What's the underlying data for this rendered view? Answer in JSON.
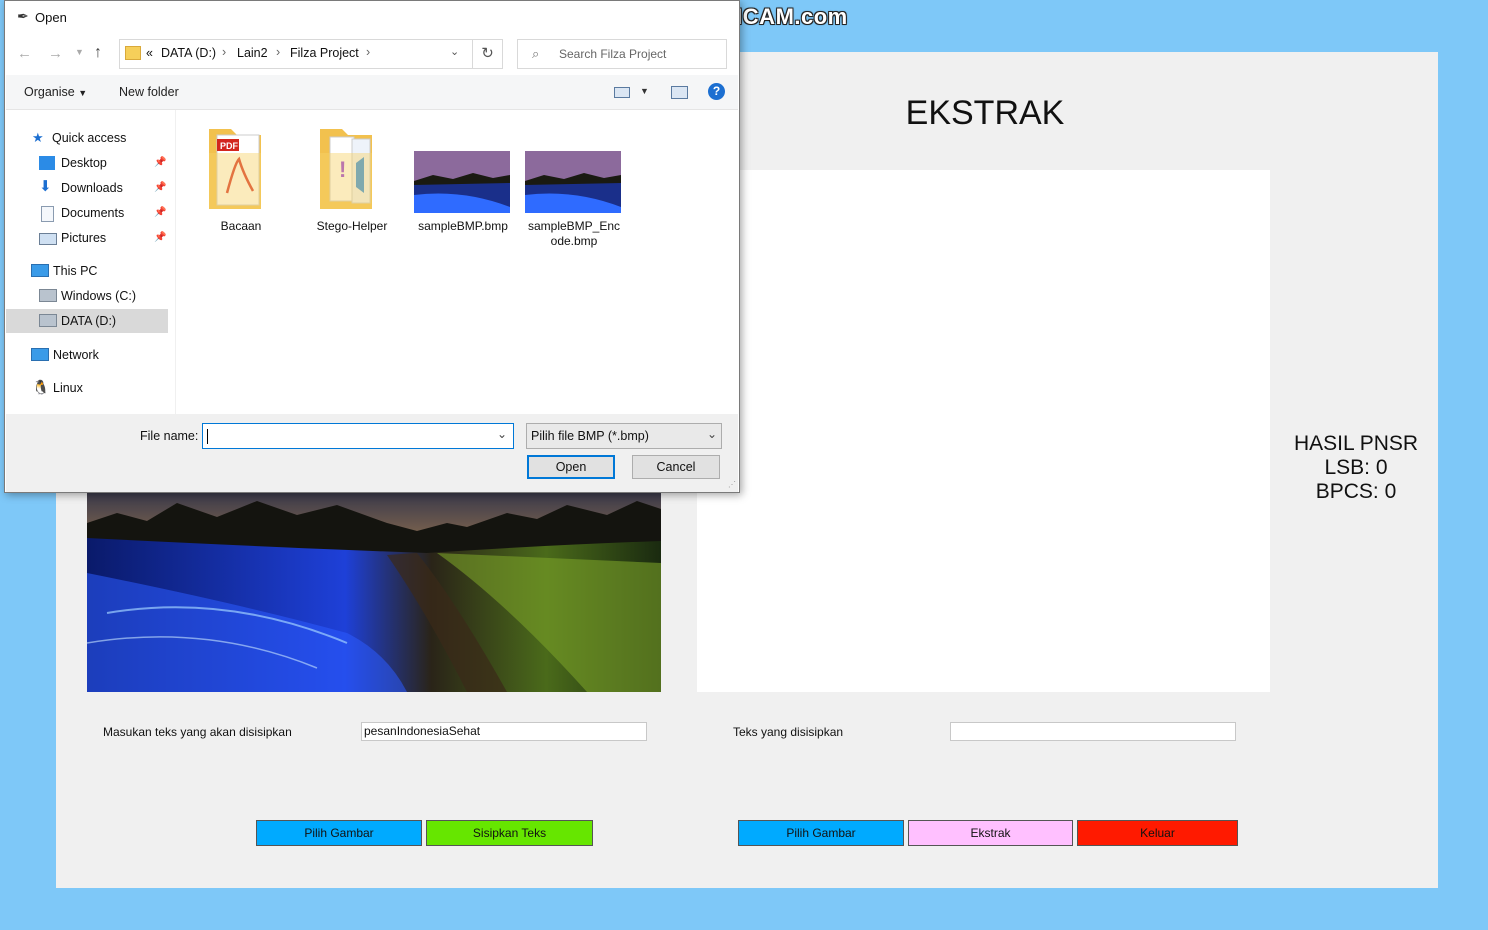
{
  "watermark": "www.BANDICAM.com",
  "app": {
    "ekstrak_title": "EKSTRAK",
    "pnsr": {
      "title": "HASIL PNSR",
      "lsb": "LSB: 0",
      "bpcs": "BPCS: 0"
    },
    "embed_label": "Masukan teks yang akan disisipkan",
    "embed_value": "pesanIndonesiaSehat",
    "extract_label": "Teks yang disisipkan",
    "extract_value": "",
    "buttons": {
      "pilih_gambar_left": "Pilih Gambar",
      "sisipkan_teks": "Sisipkan Teks",
      "pilih_gambar_right": "Pilih Gambar",
      "ekstrak": "Ekstrak",
      "keluar": "Keluar"
    },
    "colors": {
      "pilih_gambar": "#00aaff",
      "sisipkan_teks": "#66e600",
      "ekstrak": "#ffc0ff",
      "keluar": "#ff1a00",
      "background": "#7ec8f8"
    }
  },
  "dialog": {
    "title": "Open",
    "address": {
      "overflow": "«",
      "segments": [
        "DATA (D:)",
        "Lain2",
        "Filza Project"
      ]
    },
    "search_placeholder": "Search Filza Project",
    "toolbar": {
      "organise": "Organise",
      "new_folder": "New folder"
    },
    "nav": {
      "quick_access": "Quick access",
      "desktop": "Desktop",
      "downloads": "Downloads",
      "documents": "Documents",
      "pictures": "Pictures",
      "this_pc": "This PC",
      "windows_c": "Windows (C:)",
      "data_d": "DATA (D:)",
      "network": "Network",
      "linux": "Linux"
    },
    "files": [
      {
        "name": "Bacaan",
        "icon": "pdf-folder-icon"
      },
      {
        "name": "Stego-Helper",
        "icon": "folder-icon"
      },
      {
        "name": "sampleBMP.bmp",
        "icon": "bmp-thumbnail"
      },
      {
        "name": "sampleBMP_Enc\node.bmp",
        "icon": "bmp-thumbnail"
      }
    ],
    "file_name_label": "File name:",
    "file_name_value": "",
    "file_type": "Pilih file BMP (*.bmp)",
    "open_label": "Open",
    "cancel_label": "Cancel"
  }
}
